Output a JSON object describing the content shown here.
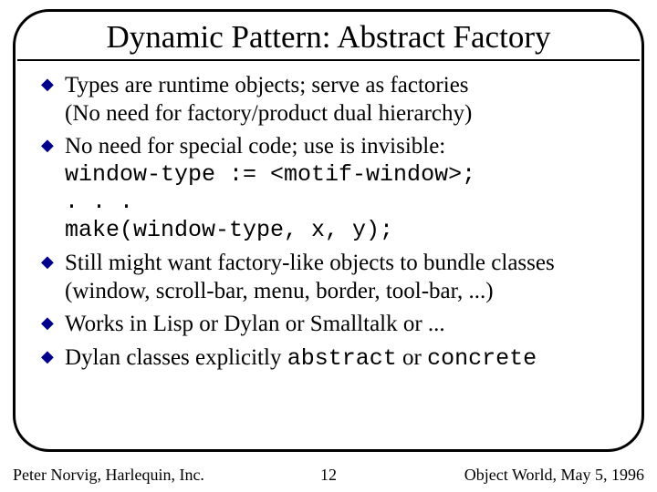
{
  "title": "Dynamic Pattern: Abstract Factory",
  "bullets": [
    {
      "lines": [
        {
          "text": "Types are runtime objects; serve as factories",
          "font": "serif"
        },
        {
          "text": "(No need for factory/product dual hierarchy)",
          "font": "serif"
        }
      ]
    },
    {
      "lines": [
        {
          "text": "No need for special code; use is invisible:",
          "font": "serif"
        },
        {
          "text": "window-type := <motif-window>;",
          "font": "mono"
        },
        {
          "text": ". . .",
          "font": "mono"
        },
        {
          "text": "make(window-type, x, y);",
          "font": "mono"
        }
      ]
    },
    {
      "lines": [
        {
          "text": "Still might want factory-like objects to bundle classes",
          "font": "serif"
        },
        {
          "text": "(window, scroll-bar, menu, border, tool-bar, ...)",
          "font": "serif"
        }
      ]
    },
    {
      "lines": [
        {
          "text": "Works in Lisp or Dylan or Smalltalk or ...",
          "font": "serif"
        }
      ]
    },
    {
      "lines": [
        {
          "spans": [
            {
              "text": "Dylan classes explicitly ",
              "font": "serif"
            },
            {
              "text": "abstract",
              "font": "mono"
            },
            {
              "text": " or ",
              "font": "serif"
            },
            {
              "text": "concrete",
              "font": "mono"
            }
          ]
        }
      ]
    }
  ],
  "footer": {
    "left": "Peter Norvig, Harlequin, Inc.",
    "center": "12",
    "right": "Object World, May 5, 1996"
  }
}
